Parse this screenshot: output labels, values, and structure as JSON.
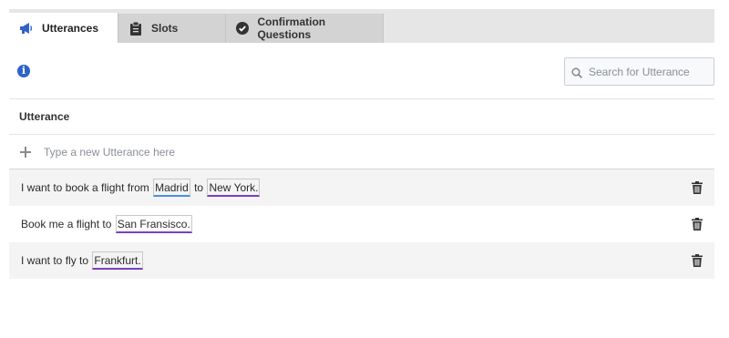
{
  "tabs": [
    {
      "label": "Utterances",
      "icon": "megaphone-icon",
      "active": true
    },
    {
      "label": "Slots",
      "icon": "clipboard-icon",
      "active": false
    },
    {
      "label": "Confirmation Questions",
      "icon": "check-circle-icon",
      "active": false
    }
  ],
  "toolbar": {
    "info_icon": "info-icon",
    "search_placeholder": "Search for Utterance"
  },
  "table": {
    "column_header": "Utterance",
    "new_placeholder": "Type a new Utterance here",
    "rows": [
      {
        "parts": [
          {
            "text": "I want to book a flight from "
          },
          {
            "text": "Madrid",
            "slot": "blue"
          },
          {
            "text": " to "
          },
          {
            "text": "New York.",
            "slot": "purple"
          }
        ]
      },
      {
        "parts": [
          {
            "text": "Book me a flight to "
          },
          {
            "text": "San Fransisco.",
            "slot": "purple"
          }
        ]
      },
      {
        "parts": [
          {
            "text": "I want to fly to "
          },
          {
            "text": "Frankfurt.",
            "slot": "purple"
          }
        ]
      }
    ]
  },
  "colors": {
    "accent": "#2f64c5",
    "slot_blue": "#4a90e2",
    "slot_purple": "#7b3fc2"
  }
}
